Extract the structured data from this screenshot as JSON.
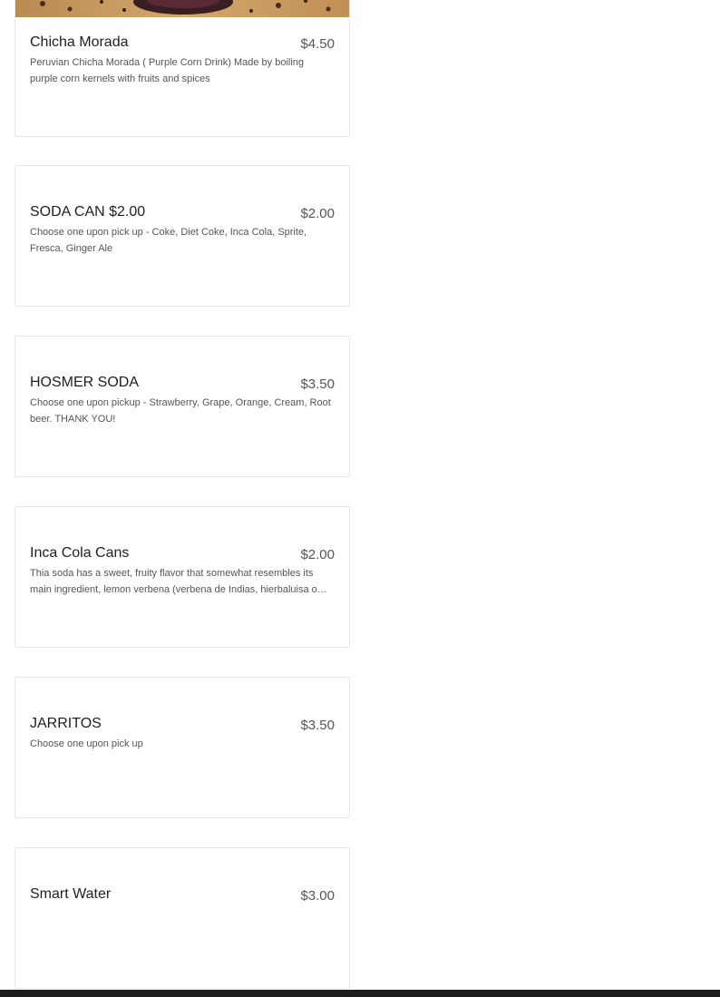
{
  "menu": {
    "items": [
      {
        "name": "Chicha Morada",
        "price": "$4.50",
        "description": "Peruvian Chicha Morada ( Purple Corn Drink) Made by boiling purple corn kernels with fruits and spices"
      },
      {
        "name": "SODA CAN $2.00",
        "price": "$2.00",
        "description": "Choose one upon pick up - Coke, Diet Coke, Inca Cola, Sprite, Fresca, Ginger Ale"
      },
      {
        "name": "HOSMER SODA",
        "price": "$3.50",
        "description": "Choose one upon pickup - Strawberry, Grape, Orange, Cream, Root beer. THANK YOU!"
      },
      {
        "name": "Inca Cola Cans",
        "price": "$2.00",
        "description": "Thia soda has a sweet, fruity flavor that somewhat resembles its main ingredient, lemon verbena (verbena de Indias, hierbaluisa o cedrón)."
      },
      {
        "name": "JARRITOS",
        "price": "$3.50",
        "description": "Choose one upon pick up"
      },
      {
        "name": "Smart Water",
        "price": "$3.00",
        "description": ""
      }
    ]
  }
}
